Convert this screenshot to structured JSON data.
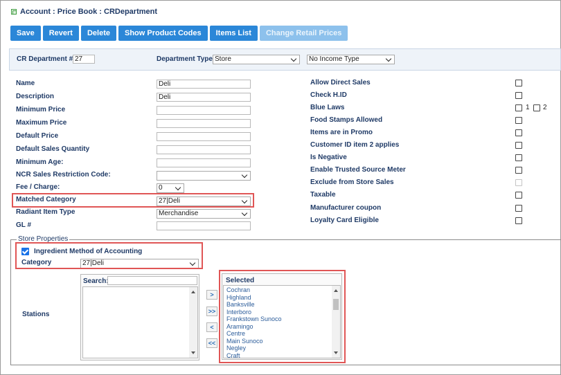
{
  "breadcrumb": "Account : Price Book : CRDepartment",
  "toolbar": {
    "save": "Save",
    "revert": "Revert",
    "delete": "Delete",
    "show_product_codes": "Show Product Codes",
    "items_list": "Items List",
    "change_retail_prices": "Change Retail Prices"
  },
  "dept": {
    "number_label": "CR Department #",
    "number_value": "27",
    "type_label": "Department Type",
    "type_value": "Store",
    "income_type_value": "No Income Type"
  },
  "form": {
    "name_label": "Name",
    "name_value": "Deli",
    "description_label": "Description",
    "description_value": "Deli",
    "min_price_label": "Minimum Price",
    "max_price_label": "Maximum Price",
    "default_price_label": "Default Price",
    "default_qty_label": "Default Sales Quantity",
    "min_age_label": "Minimum Age:",
    "ncr_label": "NCR Sales Restriction Code:",
    "fee_label": "Fee / Charge:",
    "fee_value": "0",
    "matched_label": "Matched Category",
    "matched_value": "27|Deli",
    "radiant_label": "Radiant Item Type",
    "radiant_value": "Merchandise",
    "gl_label": "GL #"
  },
  "flags": {
    "allow_direct_sales": "Allow Direct Sales",
    "check_hid": "Check H.ID",
    "blue_laws": "Blue Laws",
    "blue_law_1": "1",
    "blue_law_2": "2",
    "food_stamps": "Food Stamps Allowed",
    "items_in_promo": "Items are in Promo",
    "customer_id_item2": "Customer ID item 2 applies",
    "is_negative": "Is Negative",
    "trusted_source": "Enable Trusted Source Meter",
    "exclude_store_sales": "Exclude from Store Sales",
    "taxable": "Taxable",
    "manufacturer_coupon": "Manufacturer coupon",
    "loyalty_card": "Loyalty Card Eligible"
  },
  "store": {
    "legend": "Store Properties",
    "ingredient_label": "Ingredient Method of Accounting",
    "ingredient_checked": true,
    "category_label": "Category",
    "category_value": "27|Deli",
    "stations_label": "Stations",
    "search_label": "Search:",
    "search_value": "",
    "selected_label": "Selected",
    "move_right": ">",
    "move_all_right": ">>",
    "move_left": "<",
    "move_all_left": "<<",
    "selected_stations": [
      "Cochran",
      "Highland",
      "Banksville",
      "Interboro",
      "Frankstown Sunoco",
      "Aramingo",
      "Centre",
      "Main Sunoco",
      "Negley",
      "Craft"
    ]
  },
  "colors": {
    "button": "#2b87d8",
    "button_disabled": "#8dc1ec",
    "label_text": "#1f3a66",
    "highlight": "#e05555"
  }
}
